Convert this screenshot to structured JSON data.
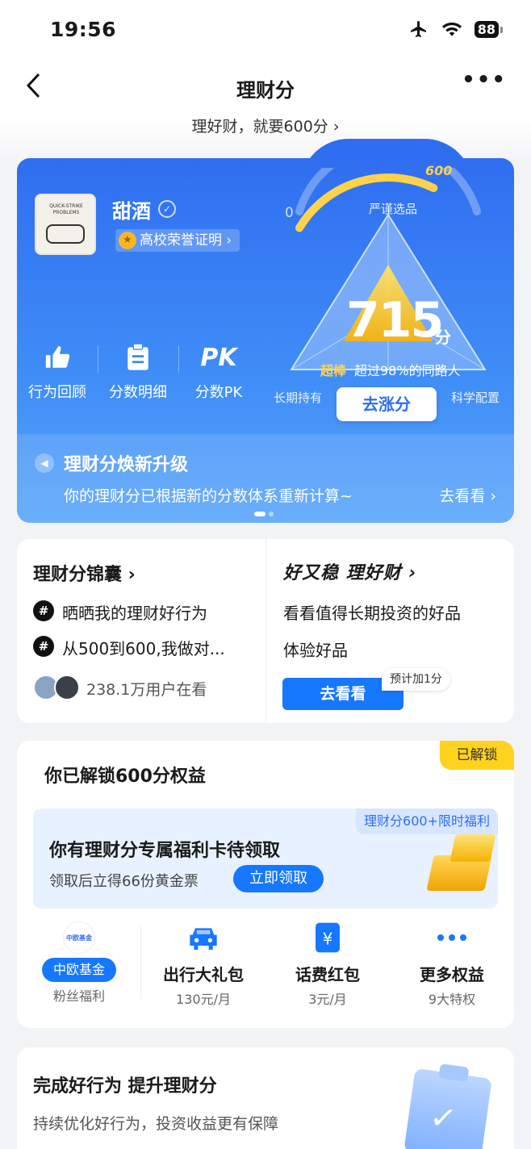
{
  "status_bar": {
    "time": "19:56",
    "battery": "88"
  },
  "nav": {
    "title": "理财分",
    "back_icon": "chevron-left-icon",
    "more_icon": "more-icon"
  },
  "banner_link": "理好财，就要600分 ›",
  "profile": {
    "avatar_text": "QUICK-STRIKE PROBLEMS",
    "name": "甜酒",
    "honor": "高校荣誉证明 ›"
  },
  "actions": [
    {
      "label": "行为回顾",
      "icon": "thumbs-up-icon"
    },
    {
      "label": "分数明细",
      "icon": "clipboard-icon"
    },
    {
      "label": "分数PK",
      "icon_text": "PK"
    }
  ],
  "score": {
    "value": "715",
    "unit": "分",
    "gauge_min": "0",
    "gauge_target": "600",
    "gauge_progress": 0.72,
    "level": "超棒",
    "exceed": "超过98%的同路人",
    "axis_top": "严谨选品",
    "axis_left": "长期持有",
    "axis_right": "科学配置",
    "button": "去涨分"
  },
  "notice": {
    "title": "理财分焕新升级",
    "desc": "你的理财分已根据新的分数体系重新计算~",
    "link": "去看看 ›"
  },
  "left_card": {
    "title": "理财分锦囊 ›",
    "items": [
      "晒晒我的理财好行为",
      "从500到600,我做对..."
    ],
    "viewers": "238.1万用户在看"
  },
  "right_card": {
    "title": "好又稳 理好财 ›",
    "line1": "看看值得长期投资的好品",
    "line2": "体验好品",
    "button": "去看看",
    "badge": "预计加1分"
  },
  "benefits": {
    "tag": "已解锁",
    "title": "你已解锁600分权益",
    "welfare": {
      "tag": "理财分600+限时福利",
      "title": "你有理财分专属福利卡待领取",
      "desc": "领取后立得66份黄金票",
      "button": "立即领取"
    },
    "perks": [
      {
        "logo": "中欧基金",
        "pill": "中欧基金",
        "sub": "粉丝福利"
      },
      {
        "name": "出行大礼包",
        "sub": "130元/月",
        "icon": "car-icon"
      },
      {
        "name": "话费红包",
        "sub": "3元/月",
        "icon": "yen-icon"
      },
      {
        "name": "更多权益",
        "sub": "9大特权",
        "icon": "more-dots-icon"
      }
    ]
  },
  "good_behavior": {
    "title": "完成好行为 提升理财分",
    "desc": "持续优化好行为，投资收益更有保障"
  }
}
